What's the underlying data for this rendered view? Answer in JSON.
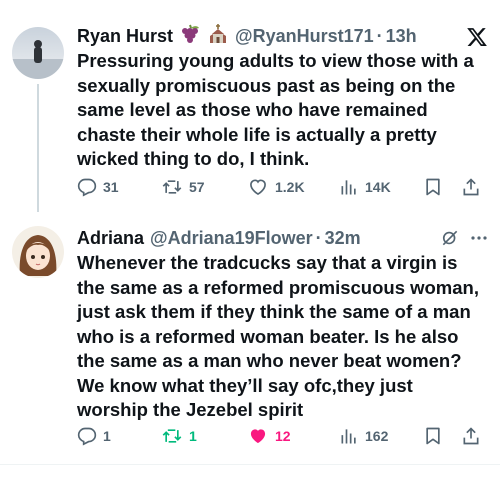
{
  "tweets": [
    {
      "name": "Ryan Hurst",
      "handle": "@RyanHurst171",
      "sep": "·",
      "time": "13h",
      "text": "Pressuring young adults to view those with a sexually promiscuous past as being on the same level as those who have remained chaste their whole life is actually a pretty wicked thing to do, I think.",
      "emojis": [
        "grapes-emoji",
        "church-emoji"
      ],
      "corner_icon": "x-logo-icon",
      "stats": {
        "replies": "31",
        "reposts": "57",
        "likes": "1.2K",
        "views": "14K"
      }
    },
    {
      "name": "Adriana",
      "handle": "@Adriana19Flower",
      "sep": "·",
      "time": "32m",
      "text": "Whenever the tradcucks say that a virgin is the same as a reformed promiscuous woman, just ask them if they think the same of a man who is a reformed woman beater. Is he also the same as a man who never beat women? We know what they’ll say ofc,they just worship the Jezebel spirit",
      "corner_icons": [
        "grok-icon",
        "more-icon"
      ],
      "stats": {
        "replies": "1",
        "reposts": "1",
        "likes": "12",
        "views": "162"
      },
      "liked": true,
      "reposted": true
    }
  ],
  "colors": {
    "text": "#0f1419",
    "secondary": "#536471",
    "like_active": "#f91880",
    "repost_active": "#00ba7c",
    "thread_line": "#cfd9de"
  }
}
